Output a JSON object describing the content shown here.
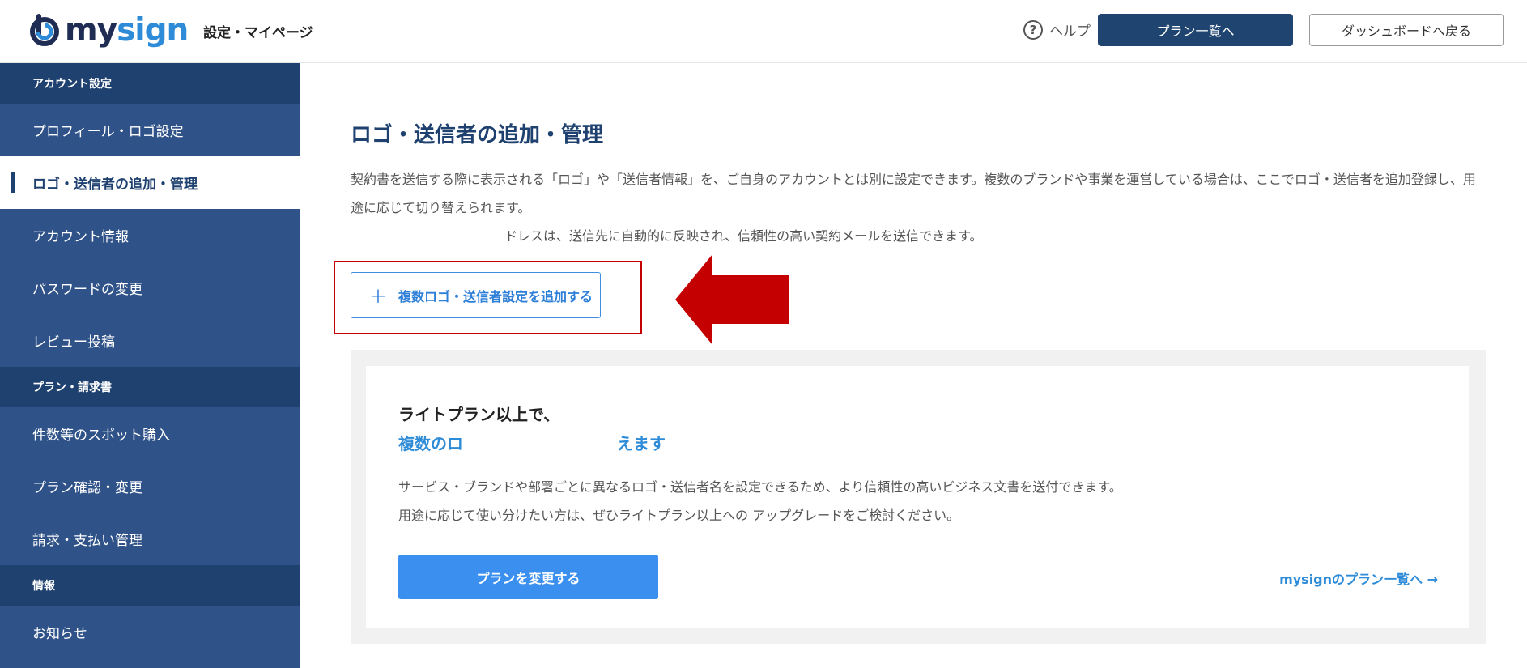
{
  "header": {
    "logo_text_main": "my",
    "logo_text_accent": "sign",
    "subtitle": "設定・マイページ",
    "help_label": "ヘルプ",
    "help_icon": "question-circle-icon",
    "plans_button": "プラン一覧へ",
    "dashboard_button": "ダッシュボードへ戻る"
  },
  "sidebar": {
    "sections": [
      {
        "title": "アカウント設定",
        "items": [
          "プロフィール・ロゴ設定",
          "ロゴ・送信者の追加・管理",
          "アカウント情報",
          "パスワードの変更",
          "レビュー投稿"
        ]
      },
      {
        "title": "プラン・請求書",
        "items": [
          "件数等のスポット購入",
          "プラン確認・変更",
          "請求・支払い管理"
        ]
      },
      {
        "title": "情報",
        "items": [
          "お知らせ"
        ]
      }
    ],
    "active_item": "ロゴ・送信者の追加・管理"
  },
  "main": {
    "title": "ロゴ・送信者の追加・管理",
    "description": "契約書を送信する際に表示される「ロゴ」や「送信者情報」を、ご自身のアカウントとは別に設定できます。複数のブランドや事業を運営している場合は、ここでロゴ・送信者を追加登録し、用途に応じて切り替えられます。",
    "description_2": "ドレスは、送信先に自動的に反映され、信頼性の高い契約メールを送信できます。",
    "add_button_icon": "plus-icon",
    "add_button_label": "複数ロゴ・送信者設定を追加する",
    "accent_color": "#2e8bd8",
    "highlight_color": "#c40000"
  },
  "promo": {
    "title_line1": "ライトプラン以上で、",
    "title_line2_start": "複数のロ",
    "title_line2_end": "えます",
    "text_line1": "サービス・ブランドや部署ごとに異なるロゴ・送信者名を設定できるため、より信頼性の高いビジネス文書を送付できます。",
    "text_line2": "用途に応じて使い分けたい方は、ぜひライトプラン以上への アップグレードをご検討ください。",
    "change_plan_button": "プランを変更する",
    "plan_list_link": "mysignのプラン一覧へ →"
  }
}
